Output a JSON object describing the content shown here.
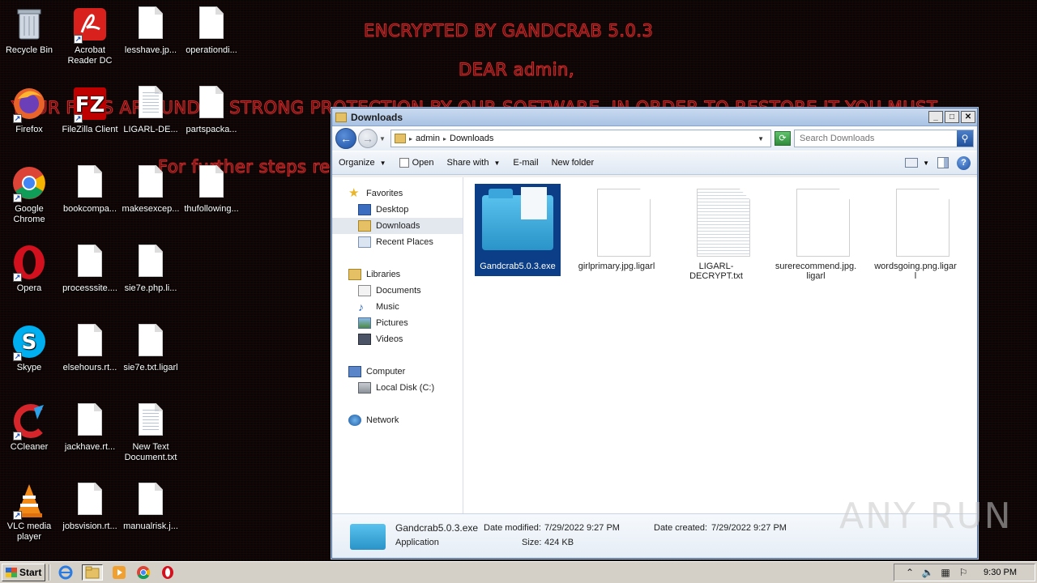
{
  "wallpaper": {
    "line1": "ENCRYPTED BY GANDCRAB 5.0.3",
    "line2": "DEAR admin,",
    "line3": "YOUR FILES ARE UNDER STRONG PROTECTION BY OUR SOFTWARE. IN ORDER TO RESTORE IT YOU MUST",
    "line4": "For further steps read"
  },
  "desktop": {
    "icons": [
      {
        "label": "Recycle Bin"
      },
      {
        "label": "Acrobat Reader DC"
      },
      {
        "label": "lesshave.jp..."
      },
      {
        "label": "operationdi..."
      },
      {
        "label": "Firefox"
      },
      {
        "label": "FileZilla Client"
      },
      {
        "label": "LIGARL-DE..."
      },
      {
        "label": "partspacka..."
      },
      {
        "label": "Google Chrome"
      },
      {
        "label": "bookcompa..."
      },
      {
        "label": "makesexcep..."
      },
      {
        "label": "thufollowing..."
      },
      {
        "label": "Opera"
      },
      {
        "label": "processsite...."
      },
      {
        "label": "sie7e.php.li..."
      },
      {
        "label": "Skype"
      },
      {
        "label": "elsehours.rt..."
      },
      {
        "label": "sie7e.txt.ligarl"
      },
      {
        "label": "CCleaner"
      },
      {
        "label": "jackhave.rt..."
      },
      {
        "label": "New Text Document.txt"
      },
      {
        "label": "VLC media player"
      },
      {
        "label": "jobsvision.rt..."
      },
      {
        "label": "manualrisk.j..."
      }
    ]
  },
  "window": {
    "title": "Downloads",
    "breadcrumb": [
      "admin",
      "Downloads"
    ],
    "search_placeholder": "Search Downloads",
    "toolbar": {
      "organize": "Organize",
      "open": "Open",
      "share_with": "Share with",
      "email": "E-mail",
      "new_folder": "New folder"
    },
    "nav": {
      "favorites": "Favorites",
      "desktop": "Desktop",
      "downloads": "Downloads",
      "recent_places": "Recent Places",
      "libraries": "Libraries",
      "documents": "Documents",
      "music": "Music",
      "pictures": "Pictures",
      "videos": "Videos",
      "computer": "Computer",
      "local_disk": "Local Disk (C:)",
      "network": "Network"
    },
    "files": [
      {
        "name": "Gandcrab5.0.3.exe",
        "icon": "folder-icon",
        "selected": true
      },
      {
        "name": "girlprimary.jpg.ligarl",
        "icon": "file-icon"
      },
      {
        "name": "LIGARL-DECRYPT.txt",
        "icon": "text-file-icon"
      },
      {
        "name": "surerecommend.jpg.ligarl",
        "icon": "file-icon"
      },
      {
        "name": "wordsgoing.png.ligarl",
        "icon": "file-icon"
      }
    ],
    "details": {
      "name": "Gandcrab5.0.3.exe",
      "type": "Application",
      "modified_label": "Date modified:",
      "modified": "7/29/2022 9:27 PM",
      "size_label": "Size:",
      "size": "424 KB",
      "created_label": "Date created:",
      "created": "7/29/2022 9:27 PM"
    }
  },
  "taskbar": {
    "start": "Start",
    "clock": "9:30 PM"
  },
  "watermark": "ANY RUN"
}
